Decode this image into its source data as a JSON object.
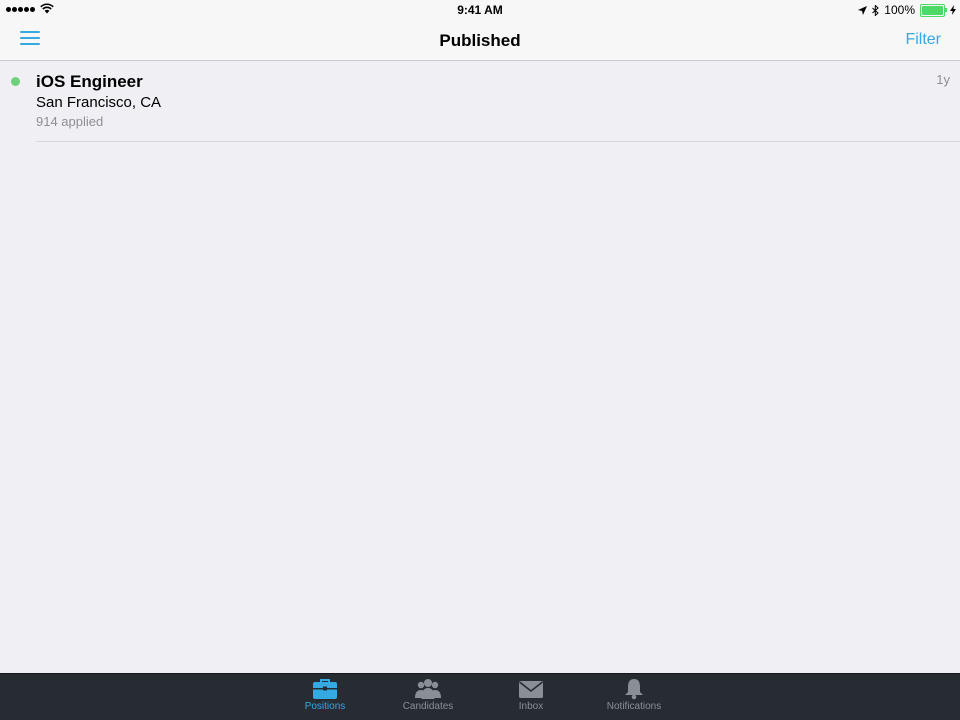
{
  "status_bar": {
    "time": "9:41 AM",
    "battery": "100%",
    "icons": [
      "signal-icon",
      "wifi-icon",
      "location-icon",
      "bluetooth-icon",
      "battery-icon",
      "charging-icon"
    ]
  },
  "nav": {
    "title": "Published",
    "filter_label": "Filter",
    "menu_icon": "hamburger-menu-icon"
  },
  "positions": [
    {
      "title": "iOS Engineer",
      "location": "San Francisco, CA",
      "applied": "914 applied",
      "age": "1y",
      "status_color": "#6fd07b"
    }
  ],
  "tabs": [
    {
      "label": "Positions",
      "icon": "briefcase-icon",
      "active": true
    },
    {
      "label": "Candidates",
      "icon": "people-icon",
      "active": false
    },
    {
      "label": "Inbox",
      "icon": "envelope-icon",
      "active": false
    },
    {
      "label": "Notifications",
      "icon": "bell-icon",
      "active": false
    }
  ],
  "colors": {
    "accent": "#35a9e1",
    "background": "#efeff4",
    "tab_bar": "#272c33",
    "status_dot": "#6fd07b"
  }
}
